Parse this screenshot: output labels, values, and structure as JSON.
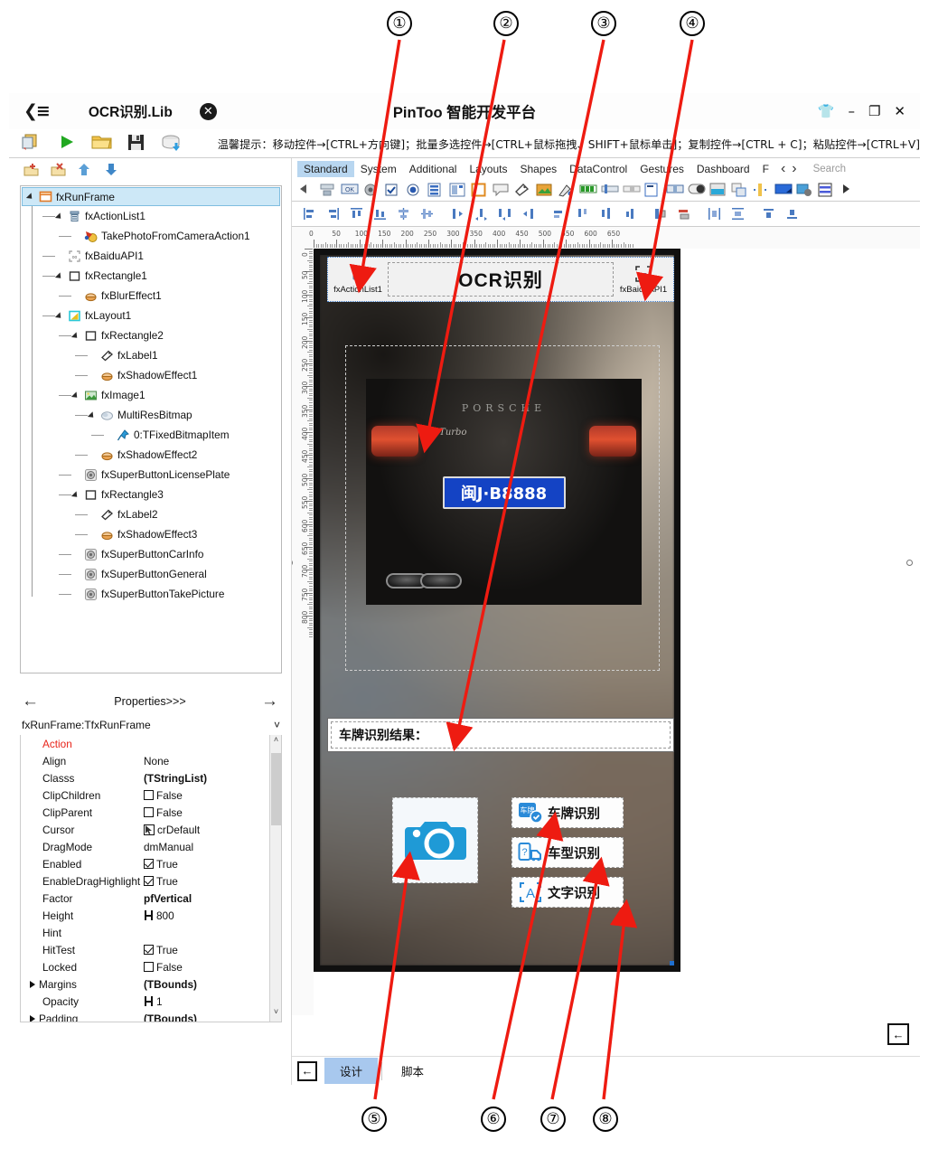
{
  "annotations": {
    "top": [
      "①",
      "②",
      "③",
      "④"
    ],
    "bottom": [
      "⑤",
      "⑥",
      "⑦",
      "⑧"
    ]
  },
  "titlebar": {
    "menu_icon": "hamburger-icon",
    "document_name": "OCR识别.Lib",
    "close_doc_icon": "✕",
    "app_title": "PinToo 智能开发平台",
    "shirt_icon": "theme-shirt-icon",
    "minimize": "–",
    "maximize": "❐",
    "close": "✕"
  },
  "toolbar": {
    "icons": [
      "new-project-icon",
      "run-icon",
      "open-folder-icon",
      "save-icon",
      "database-icon"
    ],
    "hint": "温馨提示：移动控件→[CTRL+方向键]；批量多选控件→[CTRL+鼠标拖拽、SHIFT+鼠标单击]；复制控件→[CTRL + C]；粘贴控件→[CTRL+V]"
  },
  "structure_toolbar": {
    "icons": [
      "add-node-icon",
      "delete-node-icon",
      "move-up-icon",
      "move-down-icon"
    ]
  },
  "tree": {
    "nodes": [
      {
        "label": "fxRunFrame",
        "depth": 0,
        "icon": "frame-icon",
        "expander": "open",
        "selected": true
      },
      {
        "label": "fxActionList1",
        "depth": 1,
        "icon": "actionlist-icon",
        "expander": "open",
        "selected": false
      },
      {
        "label": "TakePhotoFromCameraAction1",
        "depth": 2,
        "icon": "action-icon",
        "expander": "none",
        "selected": false
      },
      {
        "label": "fxBaiduAPI1",
        "depth": 1,
        "icon": "baiduapi-icon",
        "expander": "none",
        "selected": false
      },
      {
        "label": "fxRectangle1",
        "depth": 1,
        "icon": "rectangle-icon",
        "expander": "open",
        "selected": false
      },
      {
        "label": "fxBlurEffect1",
        "depth": 2,
        "icon": "effect-icon",
        "expander": "none",
        "selected": false
      },
      {
        "label": "fxLayout1",
        "depth": 1,
        "icon": "layout-icon",
        "expander": "open",
        "selected": false
      },
      {
        "label": "fxRectangle2",
        "depth": 2,
        "icon": "rectangle-icon",
        "expander": "open",
        "selected": false
      },
      {
        "label": "fxLabel1",
        "depth": 3,
        "icon": "label-icon",
        "expander": "none",
        "selected": false
      },
      {
        "label": "fxShadowEffect1",
        "depth": 3,
        "icon": "effect-icon",
        "expander": "none",
        "selected": false
      },
      {
        "label": "fxImage1",
        "depth": 2,
        "icon": "image-icon",
        "expander": "open",
        "selected": false
      },
      {
        "label": "MultiResBitmap",
        "depth": 3,
        "icon": "bitmap-icon",
        "expander": "open",
        "selected": false
      },
      {
        "label": "0:TFixedBitmapItem",
        "depth": 4,
        "icon": "pin-icon",
        "expander": "none",
        "selected": false
      },
      {
        "label": "fxShadowEffect2",
        "depth": 3,
        "icon": "effect-icon",
        "expander": "none",
        "selected": false
      },
      {
        "label": "fxSuperButtonLicensePlate",
        "depth": 2,
        "icon": "superbutton-icon",
        "expander": "none",
        "selected": false
      },
      {
        "label": "fxRectangle3",
        "depth": 2,
        "icon": "rectangle-icon",
        "expander": "open",
        "selected": false
      },
      {
        "label": "fxLabel2",
        "depth": 3,
        "icon": "label-icon",
        "expander": "none",
        "selected": false
      },
      {
        "label": "fxShadowEffect3",
        "depth": 3,
        "icon": "effect-icon",
        "expander": "none",
        "selected": false
      },
      {
        "label": "fxSuperButtonCarInfo",
        "depth": 2,
        "icon": "superbutton-icon",
        "expander": "none",
        "selected": false
      },
      {
        "label": "fxSuperButtonGeneral",
        "depth": 2,
        "icon": "superbutton-icon",
        "expander": "none",
        "selected": false
      },
      {
        "label": "fxSuperButtonTakePicture",
        "depth": 2,
        "icon": "superbutton-icon",
        "expander": "none",
        "selected": false
      }
    ]
  },
  "properties": {
    "header": "Properties>>>",
    "prev_icon": "arrow-left-icon",
    "next_icon": "arrow-right-icon",
    "selected_object": "fxRunFrame:TfxRunFrame",
    "dropdown_icon": "chevron-down-icon",
    "rows": [
      {
        "name": "Action",
        "value": "",
        "kind": "category"
      },
      {
        "name": "Align",
        "value": "None",
        "kind": "text"
      },
      {
        "name": "Classs",
        "value": "(TStringList)",
        "kind": "bold"
      },
      {
        "name": "ClipChildren",
        "value": "False",
        "kind": "checkbox-off"
      },
      {
        "name": "ClipParent",
        "value": "False",
        "kind": "checkbox-off"
      },
      {
        "name": "Cursor",
        "value": "crDefault",
        "kind": "cursor"
      },
      {
        "name": "DragMode",
        "value": "dmManual",
        "kind": "text"
      },
      {
        "name": "Enabled",
        "value": "True",
        "kind": "checkbox-on"
      },
      {
        "name": "EnableDragHighlight",
        "value": "True",
        "kind": "checkbox-on"
      },
      {
        "name": "Factor",
        "value": "pfVertical",
        "kind": "bold"
      },
      {
        "name": "Height",
        "value": "800",
        "kind": "measure"
      },
      {
        "name": "Hint",
        "value": "",
        "kind": "text"
      },
      {
        "name": "HitTest",
        "value": "True",
        "kind": "checkbox-on"
      },
      {
        "name": "Locked",
        "value": "False",
        "kind": "checkbox-off"
      },
      {
        "name": "Margins",
        "value": "(TBounds)",
        "kind": "expandable"
      },
      {
        "name": "Opacity",
        "value": "1",
        "kind": "measure"
      },
      {
        "name": "Padding",
        "value": "(TBounds)",
        "kind": "expandable"
      }
    ]
  },
  "palette": {
    "tabs": [
      "Standard",
      "System",
      "Additional",
      "Layouts",
      "Shapes",
      "DataControl",
      "Gestures",
      "Dashboard",
      "F"
    ],
    "active_tab": "Standard",
    "prev_icon": "chevron-left-icon",
    "next_icon": "chevron-right-icon",
    "search_placeholder": "Search"
  },
  "designer": {
    "ruler_unit": "px",
    "ruler_h_labels": [
      "0",
      "50",
      "100",
      "150",
      "200",
      "250",
      "300",
      "350",
      "400",
      "450",
      "500",
      "550",
      "600",
      "650"
    ],
    "ruler_v_labels": [
      "0",
      "50",
      "100",
      "150",
      "200",
      "250",
      "300",
      "350",
      "400",
      "450",
      "500",
      "550",
      "600",
      "650",
      "700",
      "750",
      "800"
    ],
    "form": {
      "action_list_label": "fxActionList1",
      "action_list_icon": "actionlist-icon",
      "title": "OCR识别",
      "baidu_api_label": "fxBaiduAPI1",
      "baidu_api_icon": "baiduapi-icon",
      "photo": {
        "brand_text": "PORSCHE",
        "model_text": "Cayenne Turbo",
        "license_plate": "闽J·B8888"
      },
      "result_label": "车牌识别结果：",
      "camera_icon": "camera-icon",
      "buttons": [
        {
          "label": "车牌识别",
          "icon": "license-plate-icon"
        },
        {
          "label": "车型识别",
          "icon": "car-model-icon"
        },
        {
          "label": "文字识别",
          "icon": "text-recognition-icon"
        }
      ]
    }
  },
  "bottom_tabs": {
    "collapse_icon": "collapse-left-icon",
    "tabs": [
      "设计",
      "脚本"
    ],
    "active": "设计"
  },
  "far_right": {
    "collapse_icon": "collapse-left-icon"
  },
  "colors": {
    "accent": "#b8d6f0",
    "tree_selection": "#cde8f7",
    "annotation_red": "#ee1b11",
    "category_red": "#e8241a",
    "camera_blue": "#1f9ad6",
    "plate_blue": "#1443c4"
  }
}
